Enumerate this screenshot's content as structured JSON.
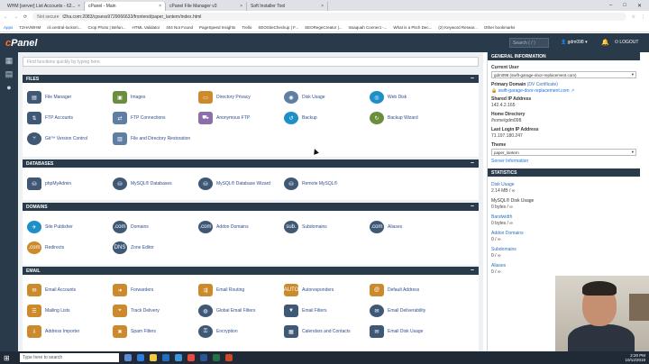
{
  "browser": {
    "tabs": [
      "WHM [server] List Accounts - 62...",
      "cPanel - Main",
      "cPanel File Manager v3",
      "Soft Installer Tool"
    ],
    "url": "t2ha.com:2083/cpsess9729066633/frontend/paper_lantern/index.html",
    "not_secure": "Not secure",
    "bookmarks": [
      "Apps",
      "T2HA/WHM",
      "cli.central-locksm...",
      "Crop Photo | Befun...",
      "HTML Validator",
      "404 Not Found",
      "PageSpeed Insights",
      "Trello",
      "SEOSiteCheckup | F...",
      "SEORegeCreator |...",
      "Issaquah Connect -...",
      "What is a Pitch Dec...",
      "(2) Keyword Resear...",
      "Other bookmarks"
    ]
  },
  "topbar": {
    "logo_c": "c",
    "logo_rest": "Panel",
    "search_placeholder": "Search ( / )",
    "user": "gdm098",
    "logout": "LOGOUT"
  },
  "main": {
    "search_placeholder": "Find functions quickly by typing here.",
    "sections": {
      "files": {
        "title": "FILES",
        "items": [
          "File Manager",
          "Images",
          "Directory Privacy",
          "Disk Usage",
          "Web Disk",
          "FTP Accounts",
          "FTP Connections",
          "Anonymous FTP",
          "Backup",
          "Backup Wizard",
          "Git™ Version Control",
          "File and Directory Restoration"
        ]
      },
      "databases": {
        "title": "DATABASES",
        "items": [
          "phpMyAdmin",
          "MySQL® Databases",
          "MySQL® Database Wizard",
          "Remote MySQL®"
        ]
      },
      "domains": {
        "title": "DOMAINS",
        "items": [
          "Site Publisher",
          "Domains",
          "Addon Domains",
          "Subdomains",
          "Aliases",
          "Redirects",
          "Zone Editor"
        ]
      },
      "email": {
        "title": "EMAIL",
        "items": [
          "Email Accounts",
          "Forwarders",
          "Email Routing",
          "Autoresponders",
          "Default Address",
          "Mailing Lists",
          "Track Delivery",
          "Global Email Filters",
          "Email Filters",
          "Email Deliverability",
          "Address Importer",
          "Spam Filters",
          "Encryption",
          "Calendars and Contacts",
          "Email Disk Usage"
        ]
      }
    }
  },
  "general": {
    "title": "GENERAL INFORMATION",
    "current_user_label": "Current User",
    "current_user": "gdm098 (swift-garage-door-replacement.com)",
    "primary_domain_label": "Primary Domain",
    "primary_domain_cert": "(DV Certificate)",
    "primary_domain": "swift-garage-door-replacement.com",
    "shared_ip_label": "Shared IP Address",
    "shared_ip": "142.4.2.165",
    "home_dir_label": "Home Directory",
    "home_dir": "/home/gdm098",
    "last_login_label": "Last Login IP Address",
    "last_login": "71.197.180.247",
    "theme_label": "Theme",
    "theme": "paper_lantern",
    "server_info": "Server Information"
  },
  "statistics": {
    "title": "STATISTICS",
    "items": [
      {
        "label": "Disk Usage",
        "value": "2.14 MB / ∞"
      },
      {
        "label": "MySQL® Disk Usage",
        "value": "0 bytes / ∞"
      },
      {
        "label": "Bandwidth",
        "value": "0 bytes / ∞"
      },
      {
        "label": "Addon Domains",
        "value": "0 / ∞"
      },
      {
        "label": "Subdomains",
        "value": "0 / ∞"
      },
      {
        "label": "Aliases",
        "value": "0 / ∞"
      }
    ]
  },
  "taskbar": {
    "search": "Type here to search",
    "time": "2:20 PM",
    "date": "10/12/2019"
  }
}
